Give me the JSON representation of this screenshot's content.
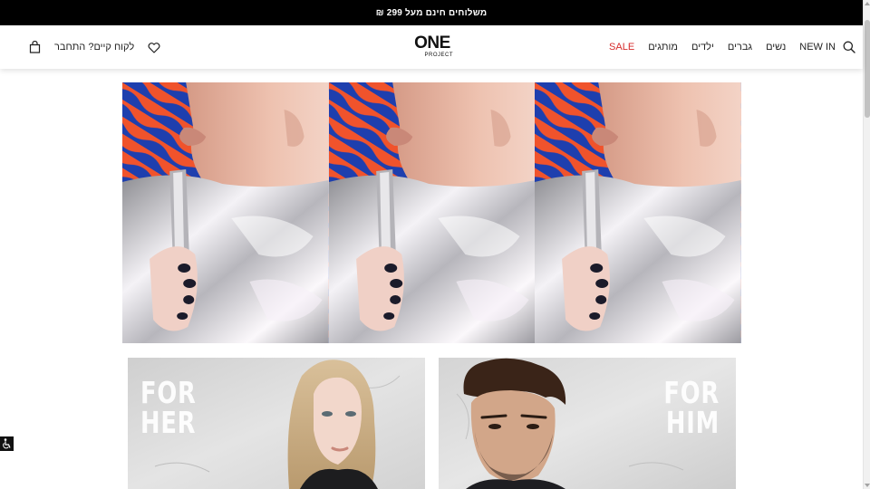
{
  "promo": {
    "text": "משלוחים חינם מעל 299 ₪"
  },
  "header": {
    "logo": {
      "main": "ONE",
      "sub": "PROJECT"
    },
    "nav": [
      "NEW IN",
      "נשים",
      "גברים",
      "ילדים",
      "מותגים",
      "SALE"
    ],
    "login_label": "לקוח קיים? התחבר",
    "icons": {
      "search": "search-icon",
      "wishlist": "heart-icon",
      "cart": "shopping-bag-icon"
    }
  },
  "hero": {
    "panel_count": 3,
    "colors": {
      "stripe_orange": "#f0532c",
      "stripe_blue": "#1e3fae",
      "skin": "#e9b9a5",
      "silver": "#c9c9cc"
    }
  },
  "categories": [
    {
      "label_line1": "FOR",
      "label_line2": "HER"
    },
    {
      "label_line1": "FOR",
      "label_line2": "HIM"
    }
  ],
  "accessibility": {
    "icon": "accessibility-icon"
  },
  "colors": {
    "promo_bg": "#000000",
    "sale": "#d62b2b",
    "text": "#222222"
  }
}
